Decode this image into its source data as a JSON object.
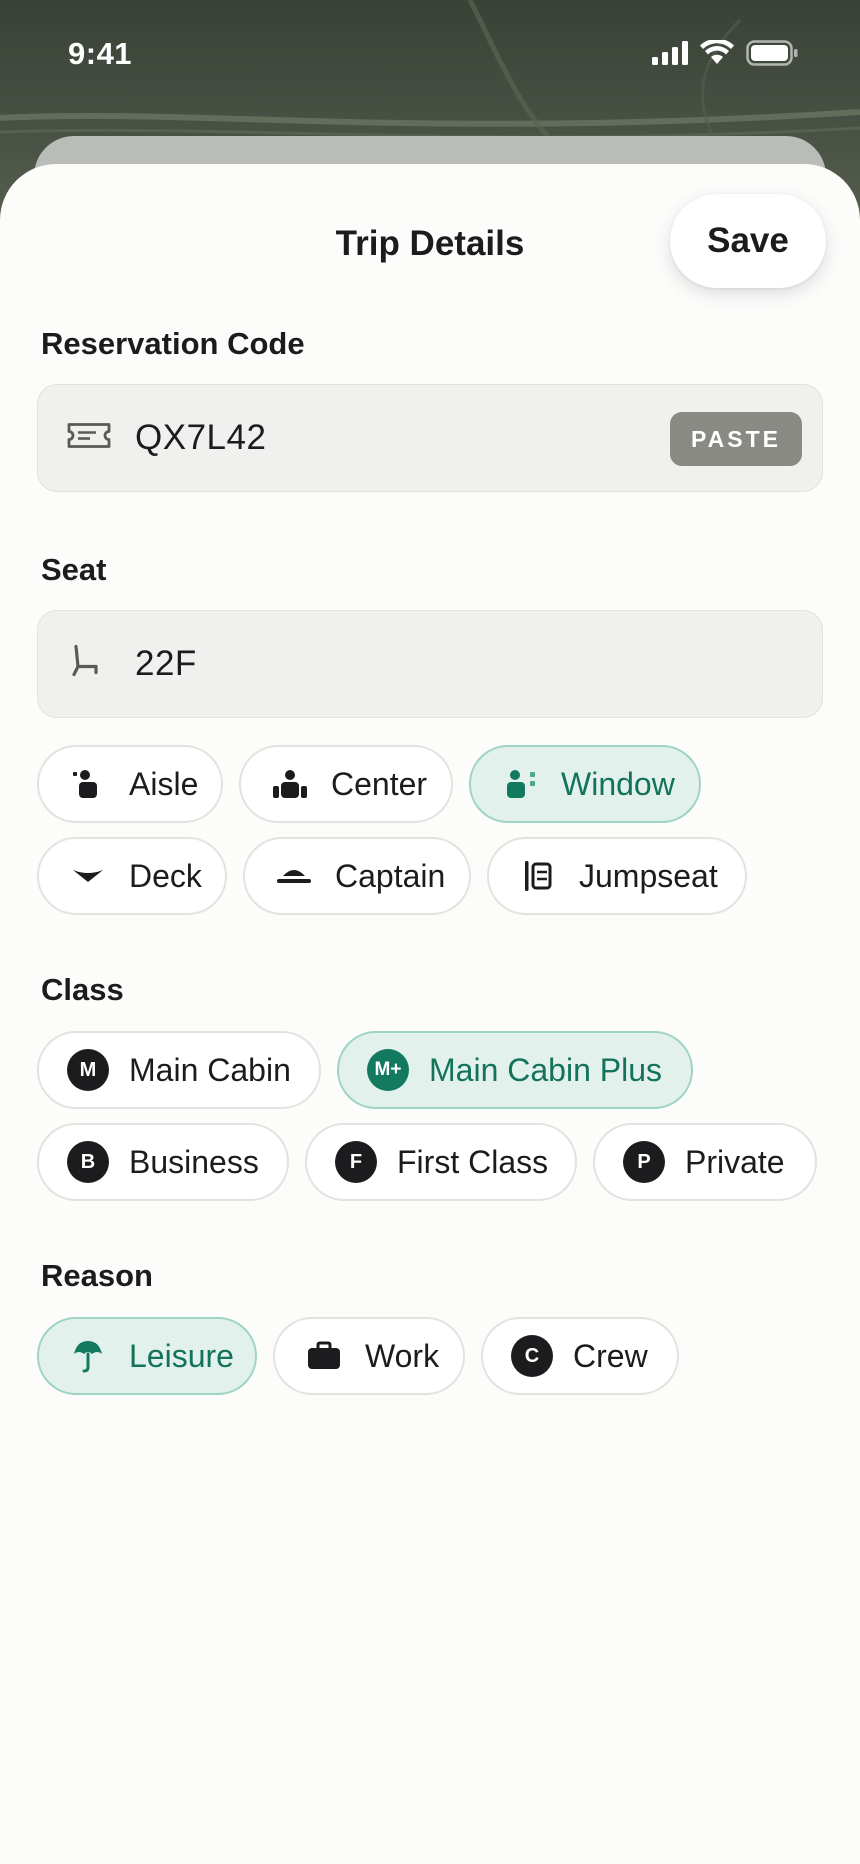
{
  "status_bar": {
    "time": "9:41"
  },
  "header": {
    "title": "Trip Details",
    "save_label": "Save"
  },
  "reservation": {
    "label": "Reservation Code",
    "value": "QX7L42",
    "paste_label": "PASTE"
  },
  "seat": {
    "label": "Seat",
    "value": "22F",
    "options": [
      {
        "label": "Aisle",
        "icon": "aisle-seat-icon",
        "selected": false
      },
      {
        "label": "Center",
        "icon": "center-seat-icon",
        "selected": false
      },
      {
        "label": "Window",
        "icon": "window-seat-icon",
        "selected": true
      },
      {
        "label": "Deck",
        "icon": "deck-icon",
        "selected": false
      },
      {
        "label": "Captain",
        "icon": "captain-hat-icon",
        "selected": false
      },
      {
        "label": "Jumpseat",
        "icon": "jumpseat-icon",
        "selected": false
      }
    ]
  },
  "class": {
    "label": "Class",
    "options": [
      {
        "label": "Main Cabin",
        "badge": "M",
        "selected": false
      },
      {
        "label": "Main Cabin Plus",
        "badge": "M+",
        "selected": true
      },
      {
        "label": "Business",
        "badge": "B",
        "selected": false
      },
      {
        "label": "First Class",
        "badge": "F",
        "selected": false
      },
      {
        "label": "Private",
        "badge": "P",
        "selected": false
      }
    ]
  },
  "reason": {
    "label": "Reason",
    "options": [
      {
        "label": "Leisure",
        "icon": "umbrella-icon",
        "selected": true
      },
      {
        "label": "Work",
        "icon": "briefcase-icon",
        "selected": false
      },
      {
        "label": "Crew",
        "badge": "C",
        "selected": false
      }
    ]
  },
  "colors": {
    "accent": "#12735a",
    "selected_bg": "#e3f1ec",
    "selected_border": "#9ed4c0",
    "field_bg": "#f0f0ee",
    "paste_bg": "#8a8a84"
  }
}
